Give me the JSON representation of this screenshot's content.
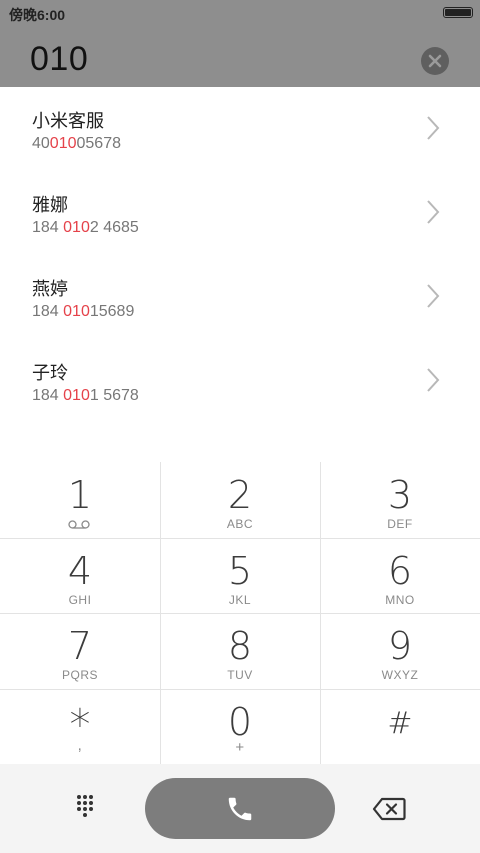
{
  "status": {
    "time": "傍晚6:00"
  },
  "dialer": {
    "value": "010"
  },
  "results": [
    {
      "name": "小米客服",
      "pre": "40",
      "hl": "010",
      "post": "05678"
    },
    {
      "name": "雅娜",
      "pre": "184 ",
      "hl": "010",
      "post": "2 4685"
    },
    {
      "name": "燕婷",
      "pre": "184 ",
      "hl": "010",
      "post": "15689"
    },
    {
      "name": "子玲",
      "pre": "184 ",
      "hl": "010",
      "post": "1 5678"
    }
  ],
  "keys": [
    {
      "digit": "1",
      "letters": ""
    },
    {
      "digit": "2",
      "letters": "ABC"
    },
    {
      "digit": "3",
      "letters": "DEF"
    },
    {
      "digit": "4",
      "letters": "GHI"
    },
    {
      "digit": "5",
      "letters": "JKL"
    },
    {
      "digit": "6",
      "letters": "MNO"
    },
    {
      "digit": "7",
      "letters": "PQRS"
    },
    {
      "digit": "8",
      "letters": "TUV"
    },
    {
      "digit": "9",
      "letters": "WXYZ"
    },
    {
      "digit": "*",
      "letters": ","
    },
    {
      "digit": "0",
      "letters": "+"
    },
    {
      "digit": "#",
      "letters": ""
    }
  ],
  "icons": {
    "clear": "close-icon",
    "chevron": "chevron-right-icon",
    "voicemail": "voicemail-icon",
    "call": "phone-icon",
    "pad": "dialpad-icon",
    "backspace": "backspace-icon",
    "battery": "battery-icon"
  },
  "colors": {
    "header": "#8e8e8e",
    "highlight": "#e5424a",
    "call_button": "#7d7d7d"
  }
}
